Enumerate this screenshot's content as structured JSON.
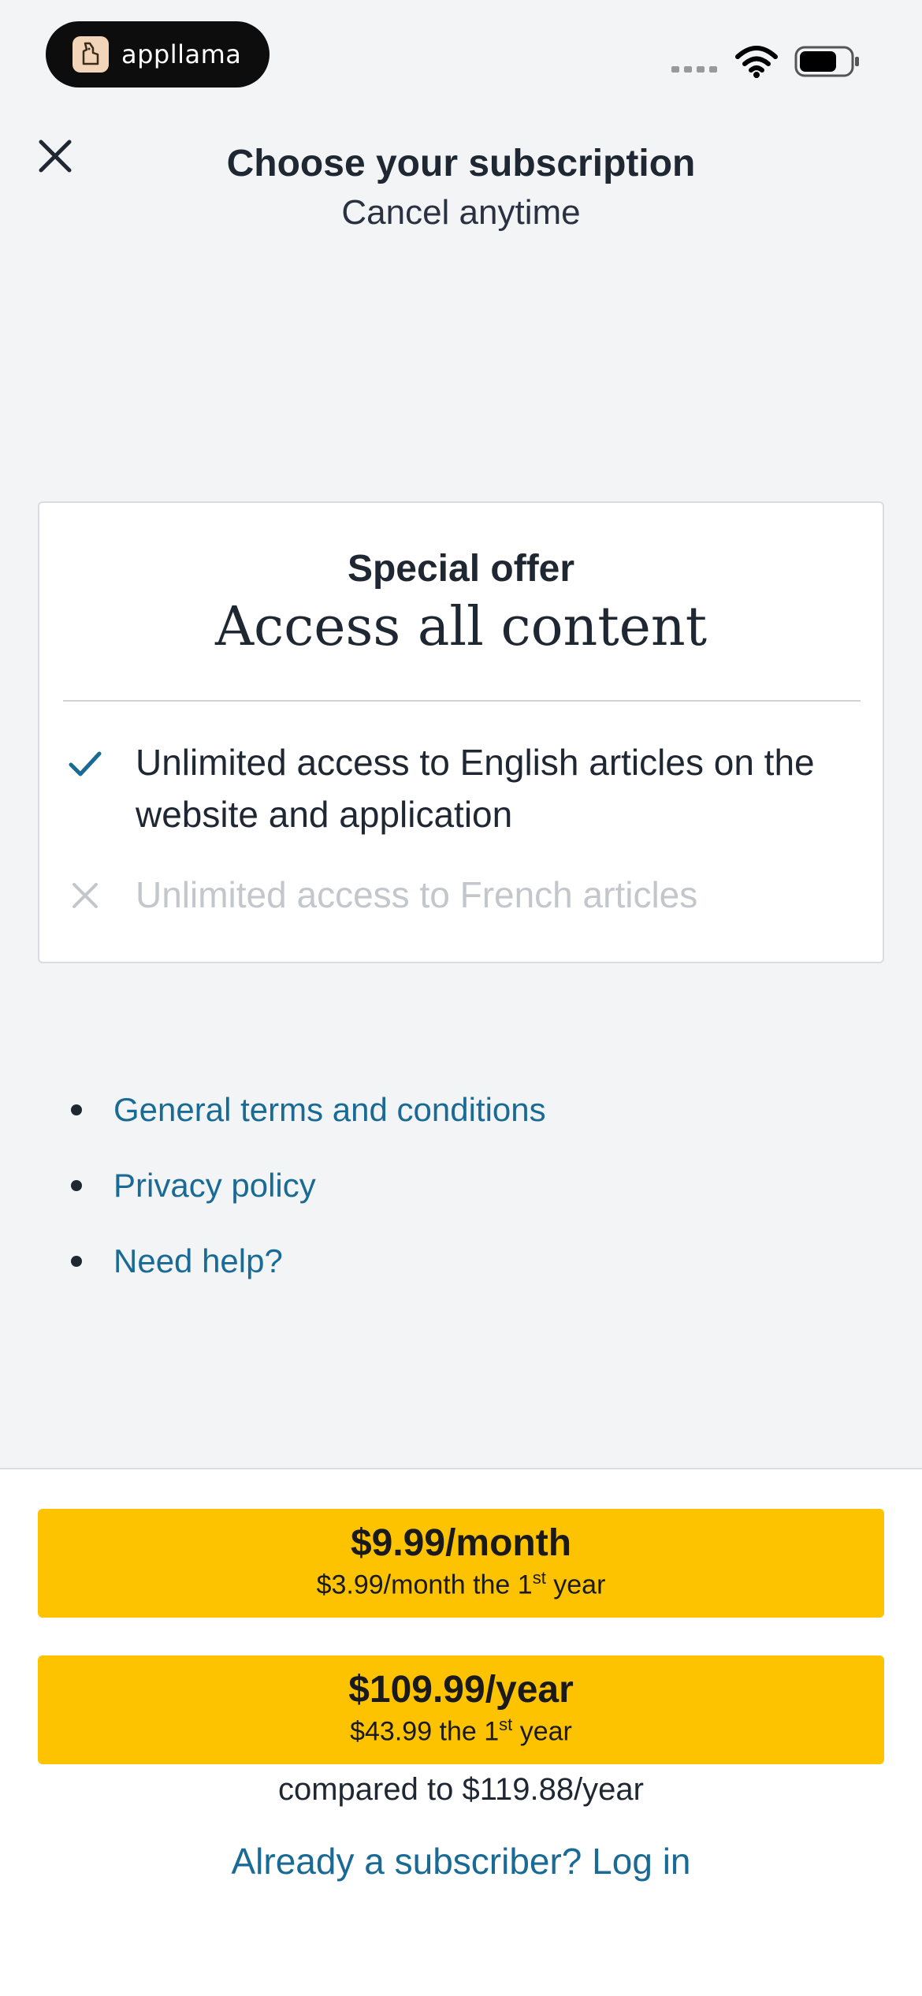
{
  "status_bar": {
    "app_name": "appllama",
    "icons": [
      "llama-logo-icon",
      "cellular-signal-icon",
      "wifi-icon",
      "battery-icon"
    ]
  },
  "header": {
    "close_icon": "close-icon",
    "title": "Choose your subscription",
    "subtitle": "Cancel anytime"
  },
  "offer": {
    "label": "Special offer",
    "title": "Access all content",
    "features": [
      {
        "text": "Unlimited access to English articles on the website and application",
        "included": true,
        "icon": "check-icon"
      },
      {
        "text": "Unlimited access to French articles",
        "included": false,
        "icon": "x-icon"
      }
    ]
  },
  "links": [
    {
      "label": "General terms and conditions"
    },
    {
      "label": "Privacy policy"
    },
    {
      "label": "Need help?"
    }
  ],
  "plans": {
    "monthly": {
      "price": "$9.99/month",
      "detail_prefix": "$3.99/month the 1",
      "detail_sup": "st",
      "detail_suffix": " year"
    },
    "yearly": {
      "price": "$109.99/year",
      "detail_prefix": "$43.99 the 1",
      "detail_sup": "st",
      "detail_suffix": " year"
    },
    "compare_text": "compared to $119.88/year"
  },
  "login_link": "Already a subscriber? Log in",
  "colors": {
    "background": "#f3f4f6",
    "accent_yellow": "#fdc300",
    "link_blue": "#1a6a96",
    "check_blue": "#1a6a96",
    "text_dark": "#1f2733",
    "muted": "#c3c6cb"
  }
}
